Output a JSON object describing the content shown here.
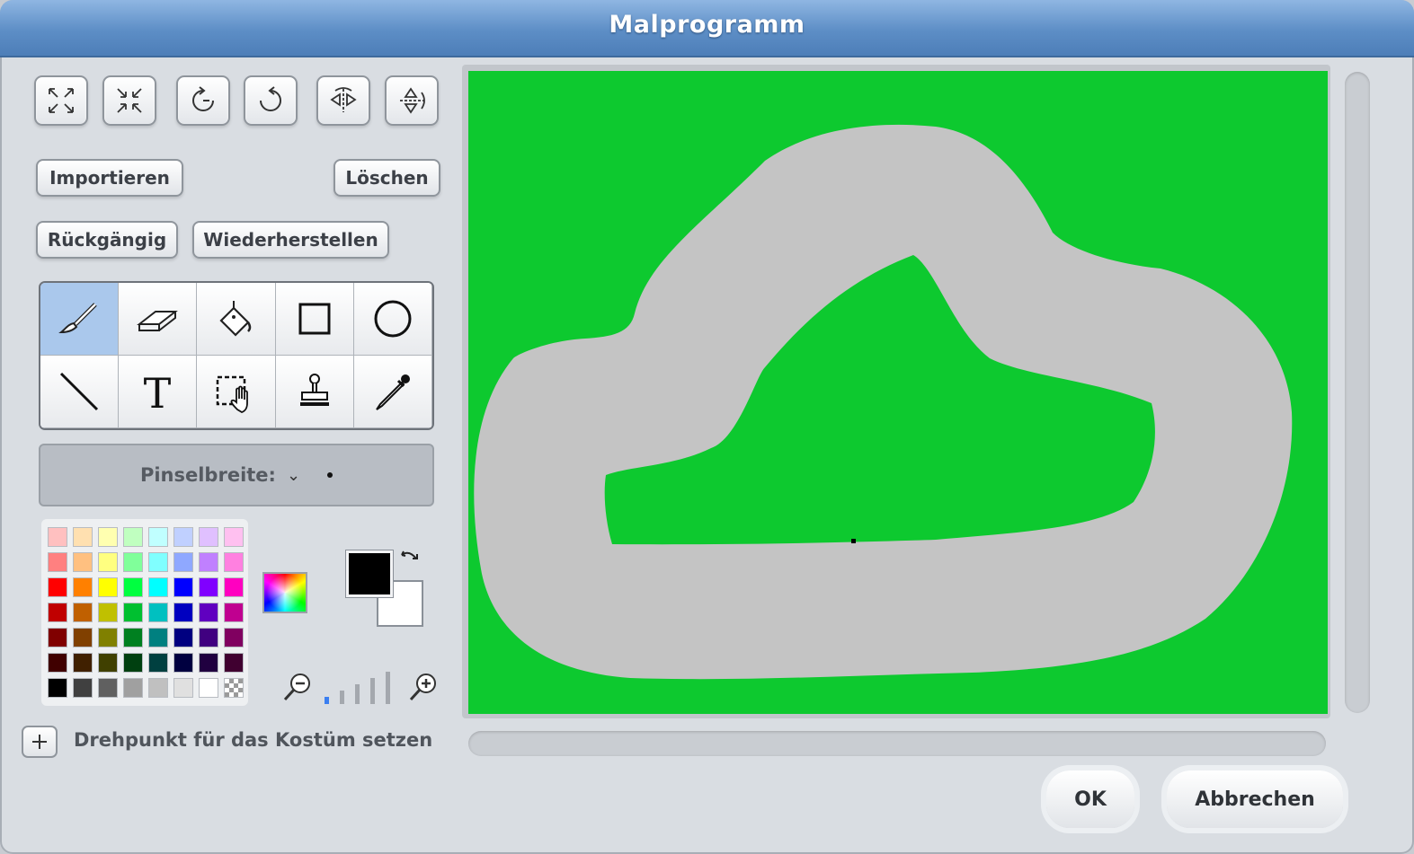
{
  "window": {
    "title": "Malprogramm"
  },
  "toolbar_top": [
    {
      "name": "grow-icon"
    },
    {
      "name": "shrink-icon"
    },
    {
      "name": "rotate-left-icon"
    },
    {
      "name": "rotate-right-icon"
    },
    {
      "name": "flip-horizontal-icon"
    },
    {
      "name": "flip-vertical-icon"
    }
  ],
  "buttons": {
    "import": "Importieren",
    "clear": "Löschen",
    "undo": "Rückgängig",
    "redo": "Wiederherstellen",
    "ok": "OK",
    "cancel": "Abbrechen"
  },
  "tools": [
    "paintbrush",
    "eraser",
    "fill",
    "rectangle",
    "ellipse",
    "line",
    "text",
    "select",
    "stamp",
    "eyedropper"
  ],
  "selected_tool": "paintbrush",
  "brush": {
    "label": "Pinselbreite:",
    "arrow": "⌄"
  },
  "palette": {
    "rows": [
      [
        "#ffc0c0",
        "#ffe0b0",
        "#ffffb0",
        "#c0ffc0",
        "#c0ffff",
        "#c0d0ff",
        "#e0c0ff",
        "#ffc0f0"
      ],
      [
        "#ff8080",
        "#ffc080",
        "#ffff80",
        "#80ff9a",
        "#80ffff",
        "#8fa8ff",
        "#c080ff",
        "#ff80e0"
      ],
      [
        "#ff0000",
        "#ff8000",
        "#ffff00",
        "#00ff40",
        "#00ffff",
        "#0000ff",
        "#8000ff",
        "#ff00c0"
      ],
      [
        "#c00000",
        "#c06000",
        "#c0c000",
        "#00c030",
        "#00c0c0",
        "#0000c0",
        "#6000c0",
        "#c00090"
      ],
      [
        "#800000",
        "#804000",
        "#808000",
        "#008020",
        "#008080",
        "#000080",
        "#400080",
        "#800060"
      ],
      [
        "#400000",
        "#402000",
        "#404000",
        "#004010",
        "#004040",
        "#000040",
        "#200040",
        "#400030"
      ],
      [
        "#000000",
        "#404040",
        "#606060",
        "#a0a0a0",
        "#c0c0c0",
        "#e0e0e0",
        "#ffffff",
        "checker"
      ]
    ]
  },
  "colors": {
    "foreground": "#000000",
    "background": "#ffffff",
    "canvas_bg": "#0dc92f",
    "track": "#c4c4c4"
  },
  "zoom": {
    "level": 1,
    "levels": 5
  },
  "rotation_center": {
    "label": "Drehpunkt für das Kostüm setzen"
  }
}
